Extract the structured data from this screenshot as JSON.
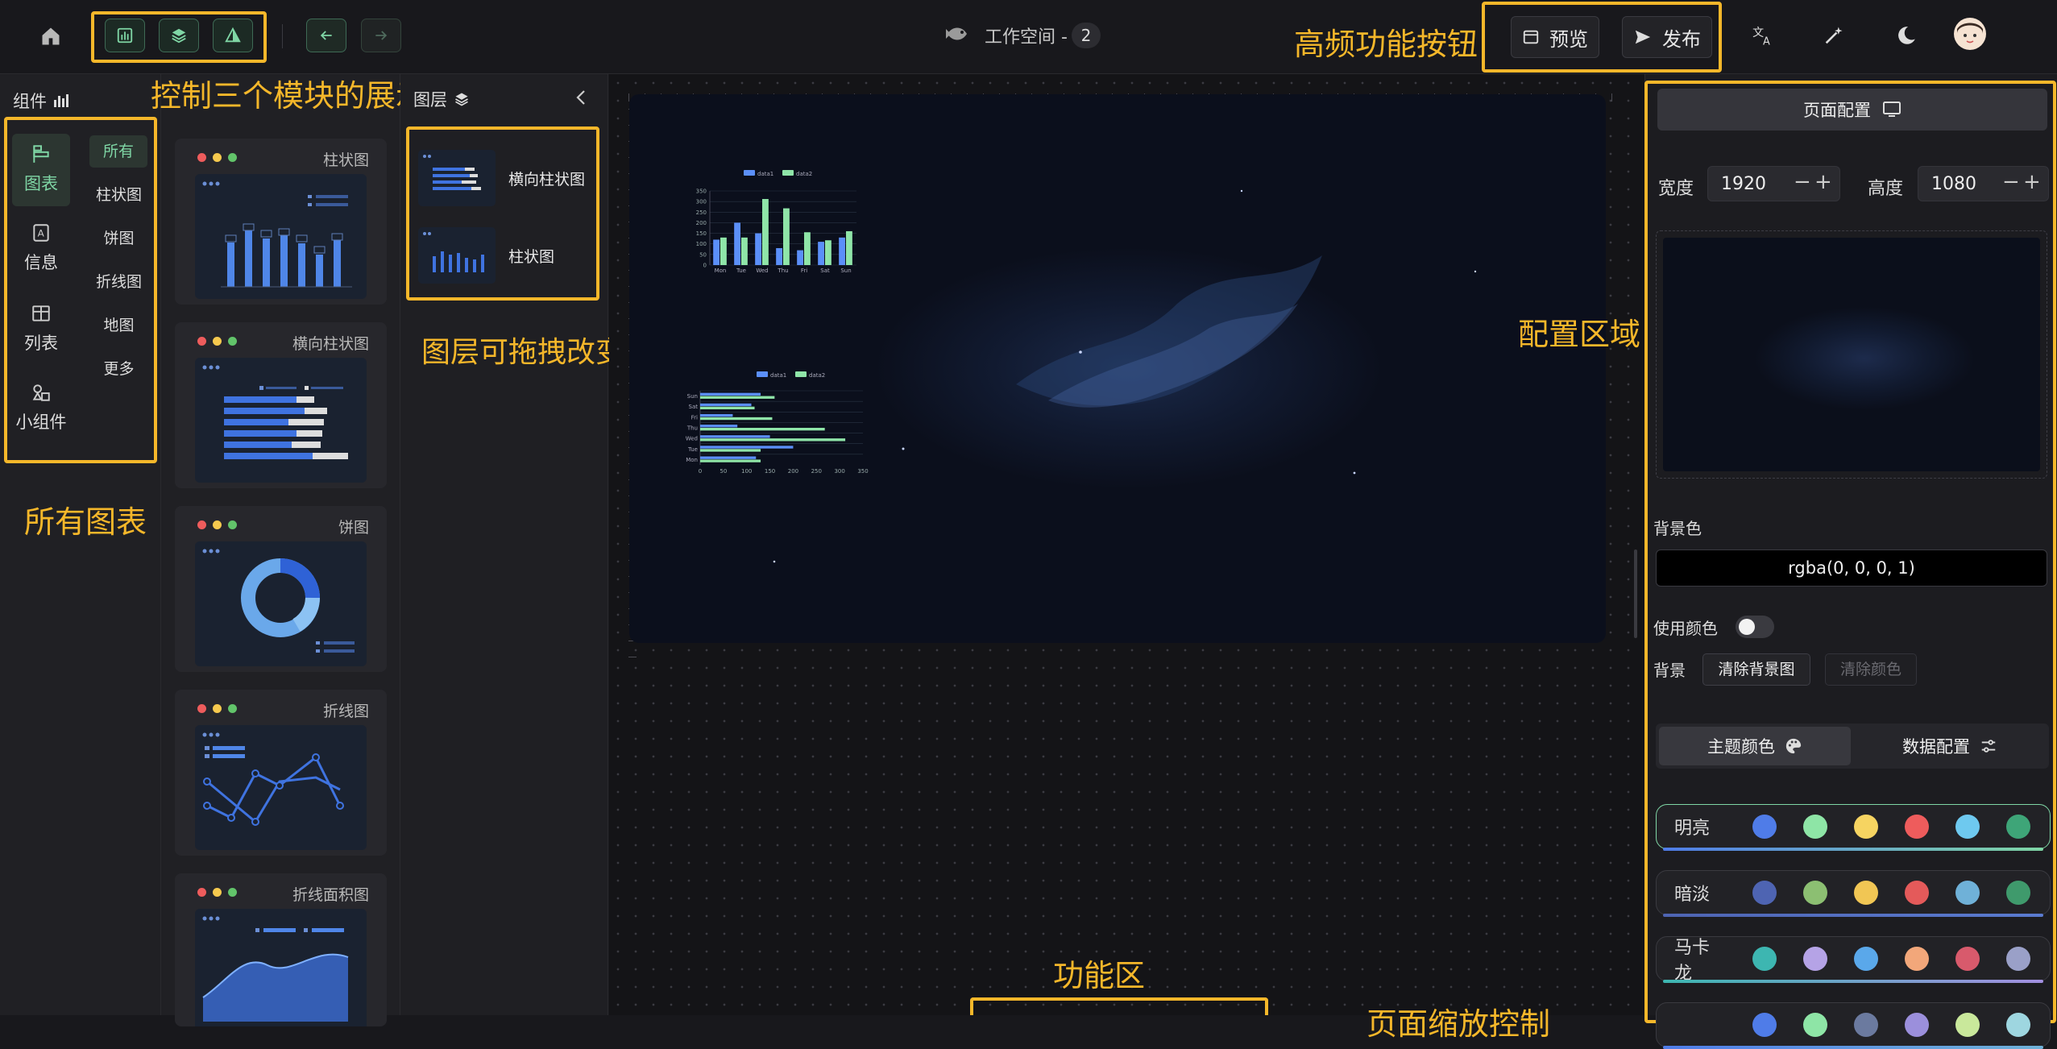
{
  "header": {
    "workspace_label": "工作空间 -",
    "workspace_count": "2",
    "preview_label": "预览",
    "publish_label": "发布"
  },
  "annotations": {
    "modules_toggle": "控制三个模块的展示",
    "high_freq_buttons": "高频功能按钮",
    "all_charts": "所有图表",
    "layers_drag": "图层可拖拽改变",
    "config_area": "配置区域",
    "function_area": "功能区",
    "page_zoom": "页面缩放控制"
  },
  "left_panel": {
    "title": "组件",
    "categories": [
      {
        "label": "图表",
        "icon": "chart-icon",
        "active": true
      },
      {
        "label": "信息",
        "icon": "info-icon",
        "active": false
      },
      {
        "label": "列表",
        "icon": "table-icon",
        "active": false
      },
      {
        "label": "小组件",
        "icon": "widget-icon",
        "active": false
      }
    ],
    "subcategories": [
      {
        "label": "所有",
        "active": true
      },
      {
        "label": "柱状图",
        "active": false
      },
      {
        "label": "饼图",
        "active": false
      },
      {
        "label": "折线图",
        "active": false
      },
      {
        "label": "地图",
        "active": false
      },
      {
        "label": "更多",
        "active": false
      }
    ]
  },
  "chart_cards": [
    {
      "title": "柱状图",
      "thumb": "bar"
    },
    {
      "title": "横向柱状图",
      "thumb": "hbar"
    },
    {
      "title": "饼图",
      "thumb": "pie"
    },
    {
      "title": "折线图",
      "thumb": "line"
    },
    {
      "title": "折线面积图",
      "thumb": "area"
    }
  ],
  "layers_panel": {
    "title": "图层",
    "items": [
      {
        "label": "横向柱状图"
      },
      {
        "label": "柱状图"
      }
    ]
  },
  "canvas_charts": {
    "bar": {
      "legend": [
        "data1",
        "data2"
      ],
      "categories": [
        "Mon",
        "Tue",
        "Wed",
        "Thu",
        "Fri",
        "Sat",
        "Sun"
      ],
      "yticks": [
        "0",
        "50",
        "100",
        "150",
        "200",
        "250",
        "300",
        "350"
      ]
    },
    "hbar": {
      "legend": [
        "data1",
        "data2"
      ],
      "categories": [
        "Sun",
        "Sat",
        "Fri",
        "Thu",
        "Wed",
        "Tue",
        "Mon"
      ],
      "xticks": [
        "0",
        "50",
        "100",
        "150",
        "200",
        "250",
        "300",
        "350"
      ]
    }
  },
  "chart_data": [
    {
      "type": "bar",
      "categories": [
        "Mon",
        "Tue",
        "Wed",
        "Thu",
        "Fri",
        "Sat",
        "Sun"
      ],
      "series": [
        {
          "name": "data1",
          "values": [
            120,
            200,
            150,
            80,
            70,
            110,
            130
          ]
        },
        {
          "name": "data2",
          "values": [
            130,
            130,
            312,
            268,
            155,
            117,
            160
          ]
        }
      ],
      "ylim": [
        0,
        350
      ],
      "colors": [
        "#5b8ff9",
        "#8fe5a8"
      ]
    },
    {
      "type": "bar",
      "orientation": "horizontal",
      "categories": [
        "Sun",
        "Sat",
        "Fri",
        "Thu",
        "Wed",
        "Tue",
        "Mon"
      ],
      "series": [
        {
          "name": "data1",
          "values": [
            130,
            110,
            70,
            80,
            150,
            200,
            120
          ]
        },
        {
          "name": "data2",
          "values": [
            160,
            117,
            155,
            268,
            312,
            130,
            130
          ]
        }
      ],
      "xlim": [
        0,
        350
      ],
      "colors": [
        "#5b8ff9",
        "#8fe5a8"
      ]
    }
  ],
  "right_panel": {
    "page_config_tab": "页面配置",
    "width_label": "宽度",
    "width_value": "1920",
    "height_label": "高度",
    "height_value": "1080",
    "bg_color_label": "背景色",
    "bg_color_value": "rgba(0, 0, 0, 1)",
    "use_color_label": "使用颜色",
    "use_color_on": false,
    "background_label": "背景",
    "clear_bg_image": "清除背景图",
    "clear_color": "清除颜色",
    "theme_tab": "主题颜色",
    "data_tab": "数据配置",
    "themes": [
      {
        "name": "明亮",
        "colors": [
          "#4f7ce8",
          "#8ee5a6",
          "#f6d461",
          "#ee5c5c",
          "#6ec9ef",
          "#3ea578"
        ],
        "bar": "#7fd6a5"
      },
      {
        "name": "暗淡",
        "colors": [
          "#4e64b2",
          "#8cbf72",
          "#f1c654",
          "#e45a5a",
          "#6fb1d8",
          "#3f9a6c"
        ],
        "bar": "#5a7bd0"
      },
      {
        "name": "马卡龙",
        "colors": [
          "#3db6b1",
          "#b5a3e6",
          "#5aa8ea",
          "#f2a77a",
          "#d85a6c",
          "#9aa0c8"
        ],
        "bar": "#a28fe0"
      },
      {
        "name": "",
        "colors": [
          "#4f7ce8",
          "#8ee5a6",
          "#6b7a9f",
          "#9b8fdc",
          "#c9e89b",
          "#9ed6e0"
        ],
        "bar": "#6fb1d8"
      }
    ]
  }
}
